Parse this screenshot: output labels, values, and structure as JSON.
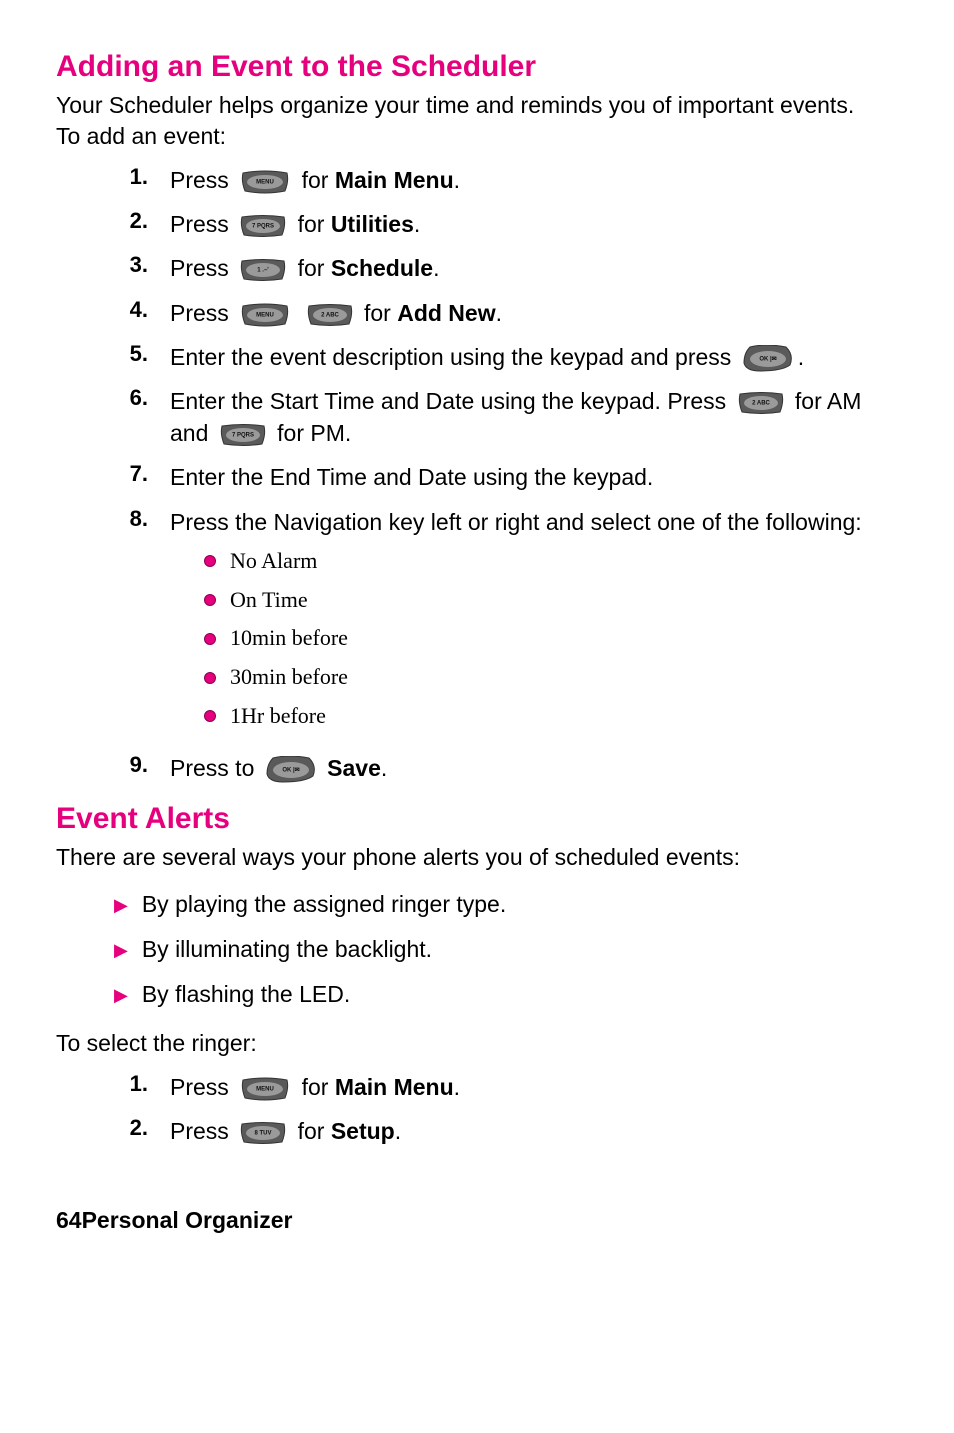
{
  "section1": {
    "title": "Adding an Event to the Scheduler",
    "intro": "Your Scheduler helps organize your time and reminds you of important events.",
    "lead": "To add an event:"
  },
  "keys": {
    "menu": "MENU",
    "7": "7 PQRS",
    "1": "1 .–'",
    "2": "2 ABC",
    "ok": "OK |✉",
    "8": "8 TUV"
  },
  "steps1": {
    "1": {
      "pre": "Press ",
      "key1": "menu",
      "mid": " for ",
      "target": "Main Menu",
      "post": "."
    },
    "2": {
      "pre": "Press ",
      "key1": "7",
      "mid": " for ",
      "target": "Utilities",
      "post": "."
    },
    "3": {
      "pre": "Press ",
      "key1": "1",
      "mid": " for ",
      "target": "Schedule",
      "post": "."
    },
    "4": {
      "pre": "Press ",
      "key1": "menu",
      "key2": "2",
      "mid": " for ",
      "target": "Add New",
      "post": "."
    },
    "5": {
      "text_a": "Enter the event description using the keypad and press ",
      "key1": "ok",
      "post": "."
    },
    "6": {
      "text_a": "Enter the Start Time and Date using the keypad. Press ",
      "key1": "2",
      "text_b": " for AM and ",
      "key2": "7",
      "text_c": " for PM."
    },
    "7": {
      "text": "Enter the End Time and Date using the keypad."
    },
    "8": {
      "text": "Press the Navigation key left or right and select one of the following:"
    },
    "9": {
      "pre": "Press to ",
      "key1": "ok",
      "mid": " ",
      "target": "Save",
      "post": "."
    }
  },
  "alarm_options": [
    "No Alarm",
    "On Time",
    "10min before",
    "30min before",
    "1Hr before"
  ],
  "section2": {
    "title": "Event Alerts",
    "intro": "There are several ways your phone alerts you of scheduled events:",
    "arrows": [
      "By playing the assigned ringer type.",
      "By illuminating the backlight.",
      "By flashing the LED."
    ],
    "lead2": "To select the ringer:"
  },
  "steps2": {
    "1": {
      "pre": "Press ",
      "key1": "menu",
      "mid": " for ",
      "target": "Main Menu",
      "post": "."
    },
    "2": {
      "pre": "Press ",
      "key1": "8",
      "mid": " for ",
      "target": "Setup",
      "post": "."
    }
  },
  "footer": {
    "page": "64",
    "label": "Personal Organizer"
  }
}
